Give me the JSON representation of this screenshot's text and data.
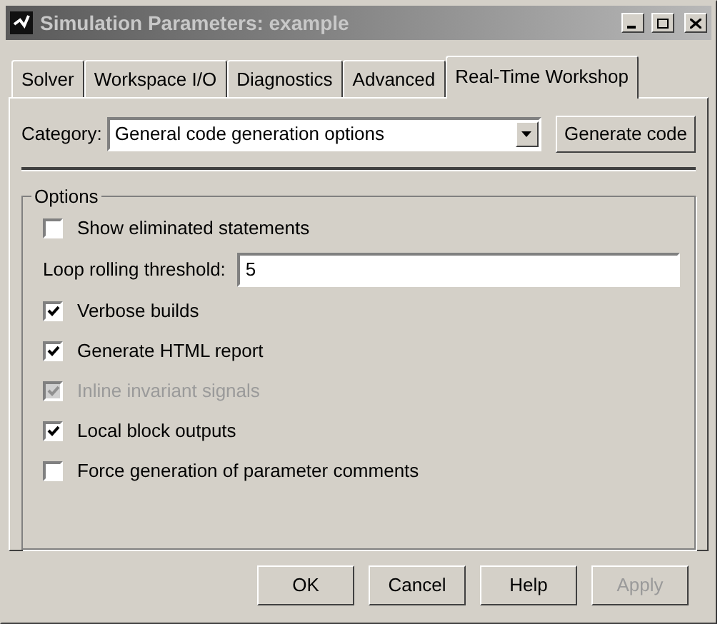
{
  "window": {
    "title": "Simulation Parameters: example"
  },
  "tabs": [
    {
      "label": "Solver",
      "selected": false
    },
    {
      "label": "Workspace I/O",
      "selected": false
    },
    {
      "label": "Diagnostics",
      "selected": false
    },
    {
      "label": "Advanced",
      "selected": false
    },
    {
      "label": "Real-Time Workshop",
      "selected": true
    }
  ],
  "category": {
    "label": "Category:",
    "value": "General code generation options"
  },
  "generate_button": "Generate code",
  "options": {
    "title": "Options",
    "items": [
      {
        "kind": "checkbox",
        "label": "Show eliminated statements",
        "checked": false,
        "disabled": false
      },
      {
        "kind": "field",
        "label": "Loop rolling threshold:",
        "value": "5"
      },
      {
        "kind": "checkbox",
        "label": "Verbose builds",
        "checked": true,
        "disabled": false
      },
      {
        "kind": "checkbox",
        "label": "Generate HTML report",
        "checked": true,
        "disabled": false
      },
      {
        "kind": "checkbox",
        "label": "Inline invariant signals",
        "checked": true,
        "disabled": true
      },
      {
        "kind": "checkbox",
        "label": "Local block outputs",
        "checked": true,
        "disabled": false
      },
      {
        "kind": "checkbox",
        "label": "Force generation of parameter comments",
        "checked": false,
        "disabled": false
      }
    ]
  },
  "buttons": [
    {
      "label": "OK",
      "disabled": false
    },
    {
      "label": "Cancel",
      "disabled": false
    },
    {
      "label": "Help",
      "disabled": false
    },
    {
      "label": "Apply",
      "disabled": true
    }
  ]
}
